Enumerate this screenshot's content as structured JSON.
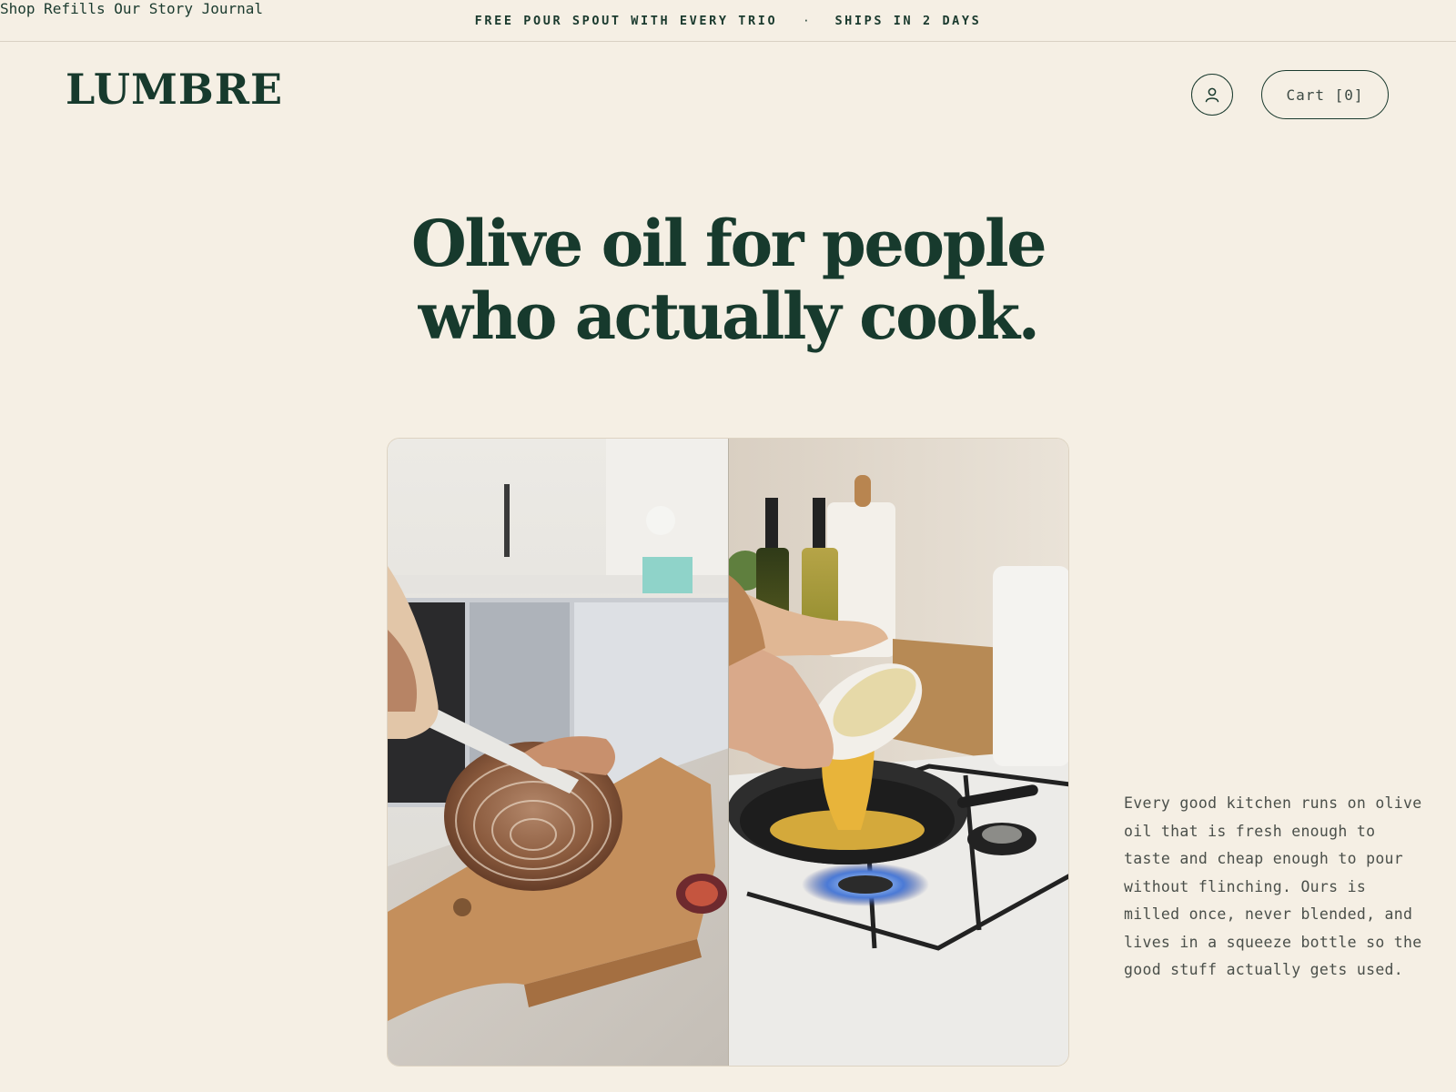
{
  "announcement": {
    "promo": "FREE POUR SPOUT WITH EVERY TRIO",
    "separator": "·",
    "shipping": "SHIPS IN 2 DAYS"
  },
  "header": {
    "logo": "LUMBRE",
    "nav": [
      "Shop",
      "Refills",
      "Our Story",
      "Journal"
    ],
    "account_icon": "user-icon",
    "cart_label": "Cart [0]"
  },
  "hero": {
    "headline_line1": "Olive oil for people",
    "headline_line2": "who actually cook.",
    "description": "Every good kitchen runs on olive oil that is fresh enough to taste and cheap enough to pour without flinching. Ours is milled once, never blended, and lives in a squeeze bottle so the good stuff actually gets used."
  },
  "colors": {
    "background": "#f5efe4",
    "brand_green": "#173a2d",
    "body_text": "#4a4f4a"
  }
}
